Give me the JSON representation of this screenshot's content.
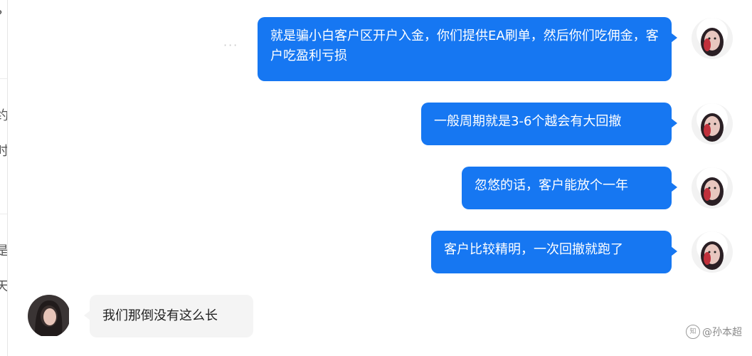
{
  "left_fragments": [
    "?",
    "约",
    "时",
    "是",
    "天"
  ],
  "typing_indicator": "···",
  "outgoing_messages": [
    {
      "text": "就是骗小白客户区开户入金，你们提供EA刷单，然后你们吃佣金，客户吃盈利亏损"
    },
    {
      "text": "一般周期就是3-6个越会有大回撤"
    },
    {
      "text": "忽悠的话，客户能放个一年"
    },
    {
      "text": "客户比较精明，一次回撤就跑了"
    }
  ],
  "incoming_messages": [
    {
      "text": "我们那倒没有这么长"
    }
  ],
  "watermark": {
    "icon": "知",
    "text": "@孙本超"
  },
  "colors": {
    "outgoing_bubble": "#1677f2",
    "incoming_bubble": "#f4f4f4"
  }
}
